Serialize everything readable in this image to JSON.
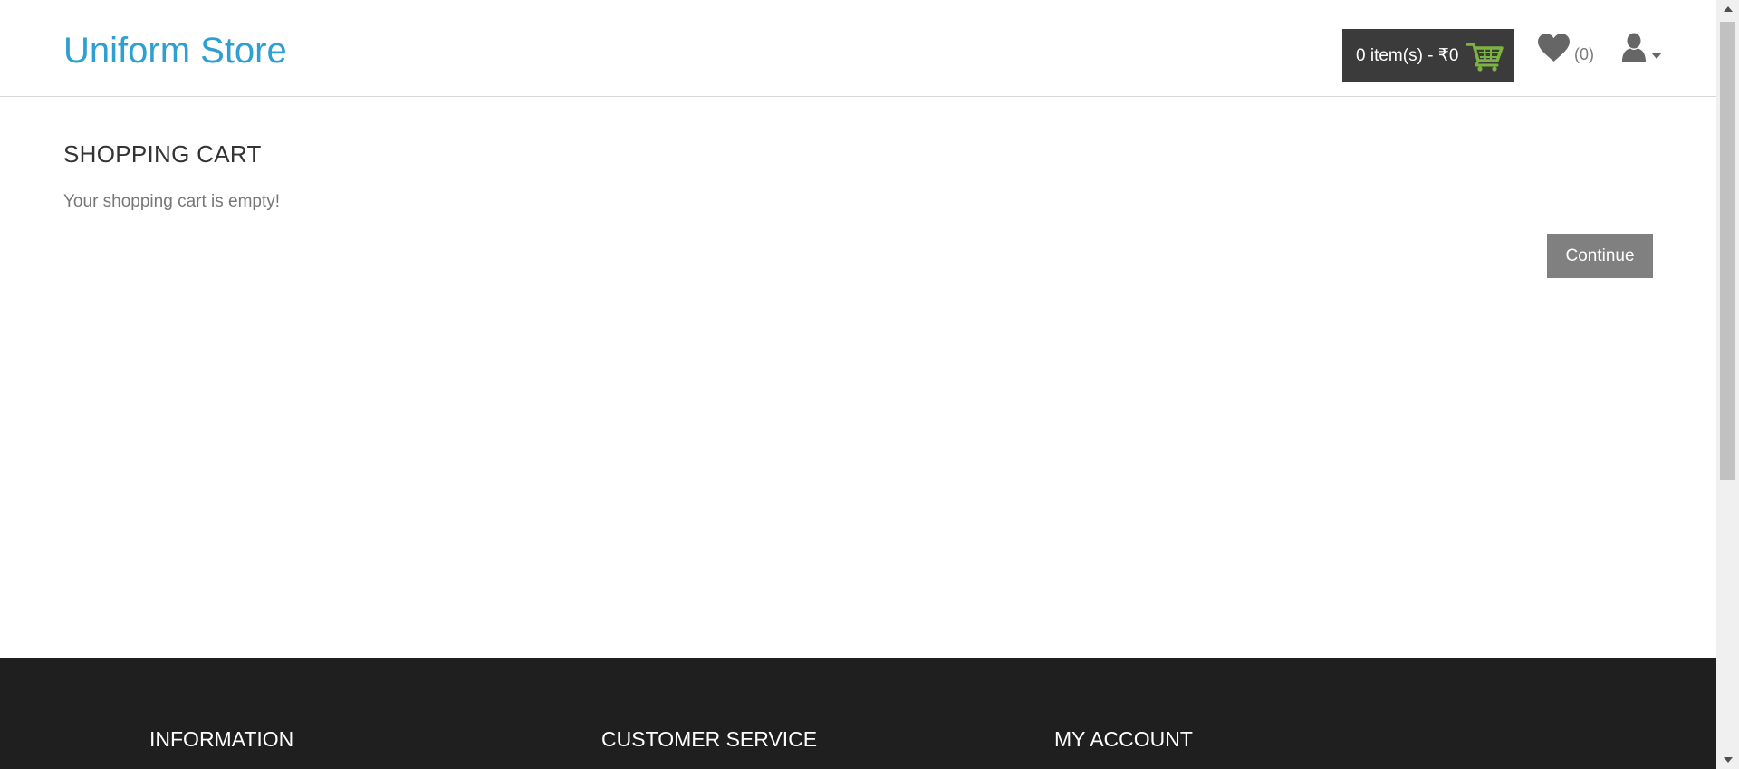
{
  "header": {
    "logo_text": "Uniform Store",
    "cart_summary": "0 item(s) - ₹0",
    "wishlist_count": "(0)"
  },
  "main": {
    "title": "SHOPPING CART",
    "empty_message": "Your shopping cart is empty!",
    "continue_label": "Continue"
  },
  "footer": {
    "headings": [
      "INFORMATION",
      "CUSTOMER SERVICE",
      "MY ACCOUNT"
    ]
  },
  "icons": {
    "cart": "shopping-cart-icon",
    "wishlist": "heart-icon",
    "account": "user-icon",
    "dropdown": "caret-down-icon"
  },
  "colors": {
    "brand": "#2e9fd1",
    "cart_bg": "#3b3b3b",
    "cart_icon": "#7cb342",
    "button_bg": "#808080",
    "footer_bg": "#1f1f1f"
  }
}
